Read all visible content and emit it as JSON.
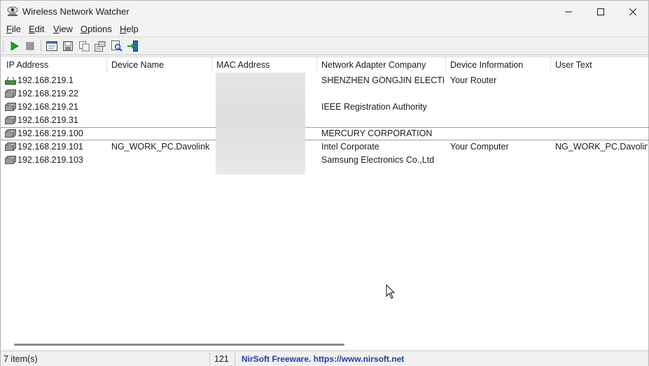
{
  "window": {
    "title": "Wireless Network Watcher",
    "icon": "eye-network-icon"
  },
  "menu": [
    {
      "label": "File",
      "mnemonic": "F",
      "rest": "ile"
    },
    {
      "label": "Edit",
      "mnemonic": "E",
      "rest": "dit"
    },
    {
      "label": "View",
      "mnemonic": "V",
      "rest": "iew"
    },
    {
      "label": "Options",
      "mnemonic": "O",
      "rest": "ptions"
    },
    {
      "label": "Help",
      "mnemonic": "H",
      "rest": "elp"
    }
  ],
  "toolbar": {
    "buttons": [
      "start-icon",
      "stop-icon",
      "html-report-icon",
      "save-icon",
      "copy-icon",
      "properties-icon",
      "find-icon",
      "exit-icon"
    ]
  },
  "columns": [
    "IP Address",
    "Device Name",
    "MAC Address",
    "Network Adapter Company",
    "Device Information",
    "User Text"
  ],
  "rows": [
    {
      "ip": "192.168.219.1",
      "device_name": "",
      "mac": "",
      "company": "SHENZHEN GONGJIN ELECTR...",
      "info": "Your Router",
      "user_text": "",
      "icon": "router-icon"
    },
    {
      "ip": "192.168.219.22",
      "device_name": "",
      "mac": "",
      "company": "",
      "info": "",
      "user_text": "",
      "icon": "computer-icon"
    },
    {
      "ip": "192.168.219.21",
      "device_name": "",
      "mac": "",
      "company": "IEEE Registration Authority",
      "info": "",
      "user_text": "",
      "icon": "computer-icon"
    },
    {
      "ip": "192.168.219.31",
      "device_name": "",
      "mac": "",
      "company": "",
      "info": "",
      "user_text": "",
      "icon": "computer-icon"
    },
    {
      "ip": "192.168.219.100",
      "device_name": "",
      "mac": "",
      "company": "MERCURY CORPORATION",
      "info": "",
      "user_text": "",
      "icon": "computer-icon"
    },
    {
      "ip": "192.168.219.101",
      "device_name": "NG_WORK_PC.Davolink",
      "mac": "",
      "company": "Intel Corporate",
      "info": "Your Computer",
      "user_text": "NG_WORK_PC.Davolink",
      "icon": "computer-icon"
    },
    {
      "ip": "192.168.219.103",
      "device_name": "",
      "mac": "",
      "company": "Samsung Electronics Co.,Ltd",
      "info": "",
      "user_text": "",
      "icon": "computer-icon"
    }
  ],
  "status": {
    "items": "7 item(s)",
    "count": "121",
    "credit": "NirSoft Freeware. https://www.nirsoft.net"
  },
  "colors": {
    "link": "#1c3fa8",
    "play": "#1aa31a",
    "router": "#3a9a3a"
  }
}
